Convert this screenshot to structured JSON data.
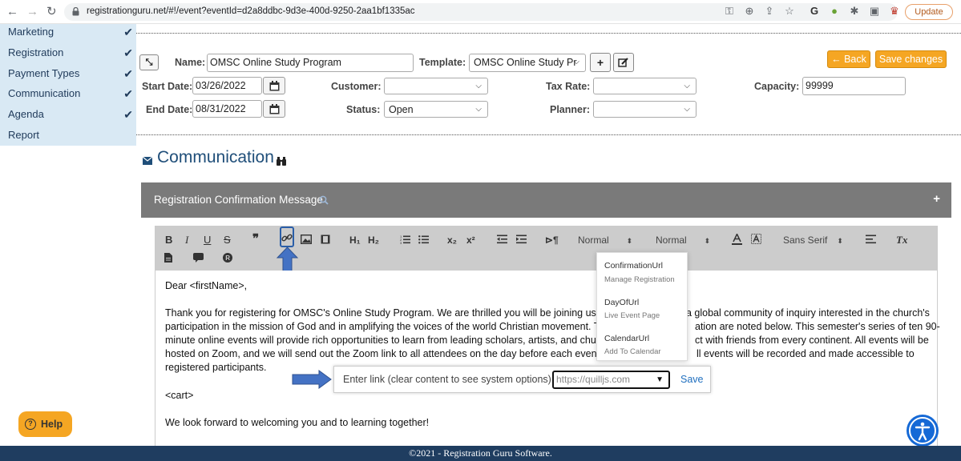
{
  "browser": {
    "url": "registrationguru.net/#!/event?eventId=d2a8ddbc-9d3e-400d-9250-2aa1bf1335ac",
    "update_label": "Update"
  },
  "sidebar": {
    "items": [
      {
        "label": "Marketing",
        "checked": true
      },
      {
        "label": "Registration",
        "checked": true
      },
      {
        "label": "Payment Types",
        "checked": true
      },
      {
        "label": "Communication",
        "checked": true
      },
      {
        "label": "Agenda",
        "checked": true
      },
      {
        "label": "Report",
        "checked": false
      }
    ],
    "check_glyph": "✔"
  },
  "form": {
    "name_label": "Name:",
    "name_value": "OMSC Online Study Program",
    "template_label": "Template:",
    "template_value": "OMSC Online Study Pr",
    "back_label": "← Back",
    "save_changes_label": "Save changes",
    "start_date_label": "Start Date:",
    "start_date_value": "03/26/2022",
    "end_date_label": "End Date:",
    "end_date_value": "08/31/2022",
    "customer_label": "Customer:",
    "customer_value": "",
    "status_label": "Status:",
    "status_value": "Open",
    "tax_rate_label": "Tax Rate:",
    "tax_rate_value": "",
    "planner_label": "Planner:",
    "planner_value": "",
    "capacity_label": "Capacity:",
    "capacity_value": "99999"
  },
  "section": {
    "title": "Communication"
  },
  "panel": {
    "title": "Registration Confirmation Message",
    "expand_glyph": "+"
  },
  "toolbar": {
    "bold": "B",
    "italic": "I",
    "underline": "U",
    "strike": "S",
    "quote": "❞",
    "h1": "H₁",
    "h2": "H₂",
    "sub": "x₂",
    "sup": "x²",
    "rtl": "⊳¶",
    "size1": "Normal",
    "size2": "Normal",
    "font": "Sans Serif",
    "clear": "Tx"
  },
  "editor": {
    "greeting": "Dear <firstName>,",
    "para1_line1": "Thank you for registering for OMSC's Online Study Program. We are thrilled you will be joining us as",
    "para1_line1b": "a global community of inquiry interested in the church's",
    "para1_line2": "participation in the mission of God and in amplifying the voices of the world Christian movement. The",
    "para1_line2b": "ation are noted below. This semester's series of ten 90-",
    "para1_line3": "minute online events will provide rich opportunities to learn from leading scholars, artists, and church",
    "para1_line3b": "ct with friends from every continent.  All events will be",
    "para1_line4": "hosted on Zoom, and we will send out the Zoom link to all attendees on the day before each event. Pl",
    "para1_line4b": "ll events will be recorded and made accessible to",
    "para1_line5": "registered participants.",
    "cart": "<cart>",
    "closing": "We look forward to welcoming you and to learning together!"
  },
  "link_popup": {
    "label": "Enter link (clear content to see system options):",
    "placeholder": "https://quilljs.com",
    "save_label": "Save"
  },
  "system_options": [
    {
      "title": "ConfirmationUrl",
      "subtitle": "Manage Registration"
    },
    {
      "title": "DayOfUrl",
      "subtitle": "Live Event Page"
    },
    {
      "title": "CalendarUrl",
      "subtitle": "Add To Calendar"
    }
  ],
  "footer": {
    "text": "©2021 - Registration Guru Software."
  },
  "help": {
    "label": "Help"
  },
  "colors": {
    "accent_orange": "#f5a623",
    "sidebar_bg": "#d9e9f4",
    "footer_bg": "#1f3d60",
    "annotation_blue": "#4472c4"
  }
}
